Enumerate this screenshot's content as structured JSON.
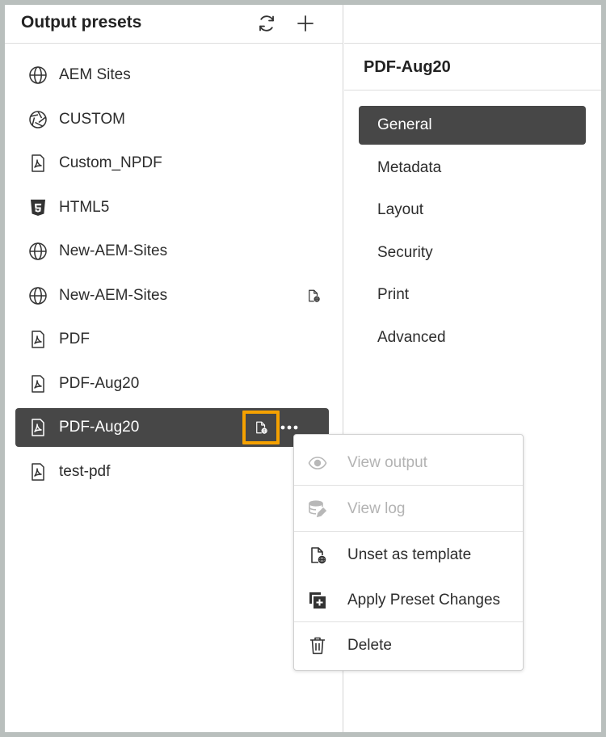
{
  "left_panel": {
    "title": "Output presets",
    "refresh_icon": "refresh-icon",
    "add_icon": "plus-icon",
    "presets": [
      {
        "label": "AEM Sites",
        "icon": "globe-icon"
      },
      {
        "label": "CUSTOM",
        "icon": "aperture-icon"
      },
      {
        "label": "Custom_NPDF",
        "icon": "pdf-file-icon"
      },
      {
        "label": "HTML5",
        "icon": "html5-icon"
      },
      {
        "label": "New-AEM-Sites",
        "icon": "globe-icon"
      },
      {
        "label": "New-AEM-Sites",
        "icon": "globe-icon",
        "template_badge": true
      },
      {
        "label": "PDF",
        "icon": "pdf-file-icon"
      },
      {
        "label": "PDF-Aug20",
        "icon": "pdf-file-icon"
      },
      {
        "label": "PDF-Aug20",
        "icon": "pdf-file-icon",
        "selected": true,
        "template_badge": true,
        "highlighted_badge": true,
        "more_menu": true
      },
      {
        "label": "test-pdf",
        "icon": "pdf-file-icon"
      }
    ]
  },
  "right_panel": {
    "title": "PDF-Aug20",
    "nav": [
      {
        "label": "General",
        "active": true
      },
      {
        "label": "Metadata"
      },
      {
        "label": "Layout"
      },
      {
        "label": "Security"
      },
      {
        "label": "Print"
      },
      {
        "label": "Advanced"
      }
    ]
  },
  "context_menu": {
    "items": [
      {
        "label": "View output",
        "icon": "eye-icon",
        "disabled": true
      },
      {
        "label": "View log",
        "icon": "log-stack-icon",
        "disabled": true
      },
      {
        "label": "Unset as template",
        "icon": "template-file-icon",
        "disabled": false
      },
      {
        "label": "Apply Preset Changes",
        "icon": "apply-copy-icon",
        "disabled": false
      },
      {
        "label": "Delete",
        "icon": "trash-icon",
        "disabled": false
      }
    ]
  },
  "colors": {
    "selected_bg": "#474747",
    "highlight_border": "#f5a100",
    "disabled_text": "#b3b3b3",
    "frame_border": "#b9bfbd"
  }
}
